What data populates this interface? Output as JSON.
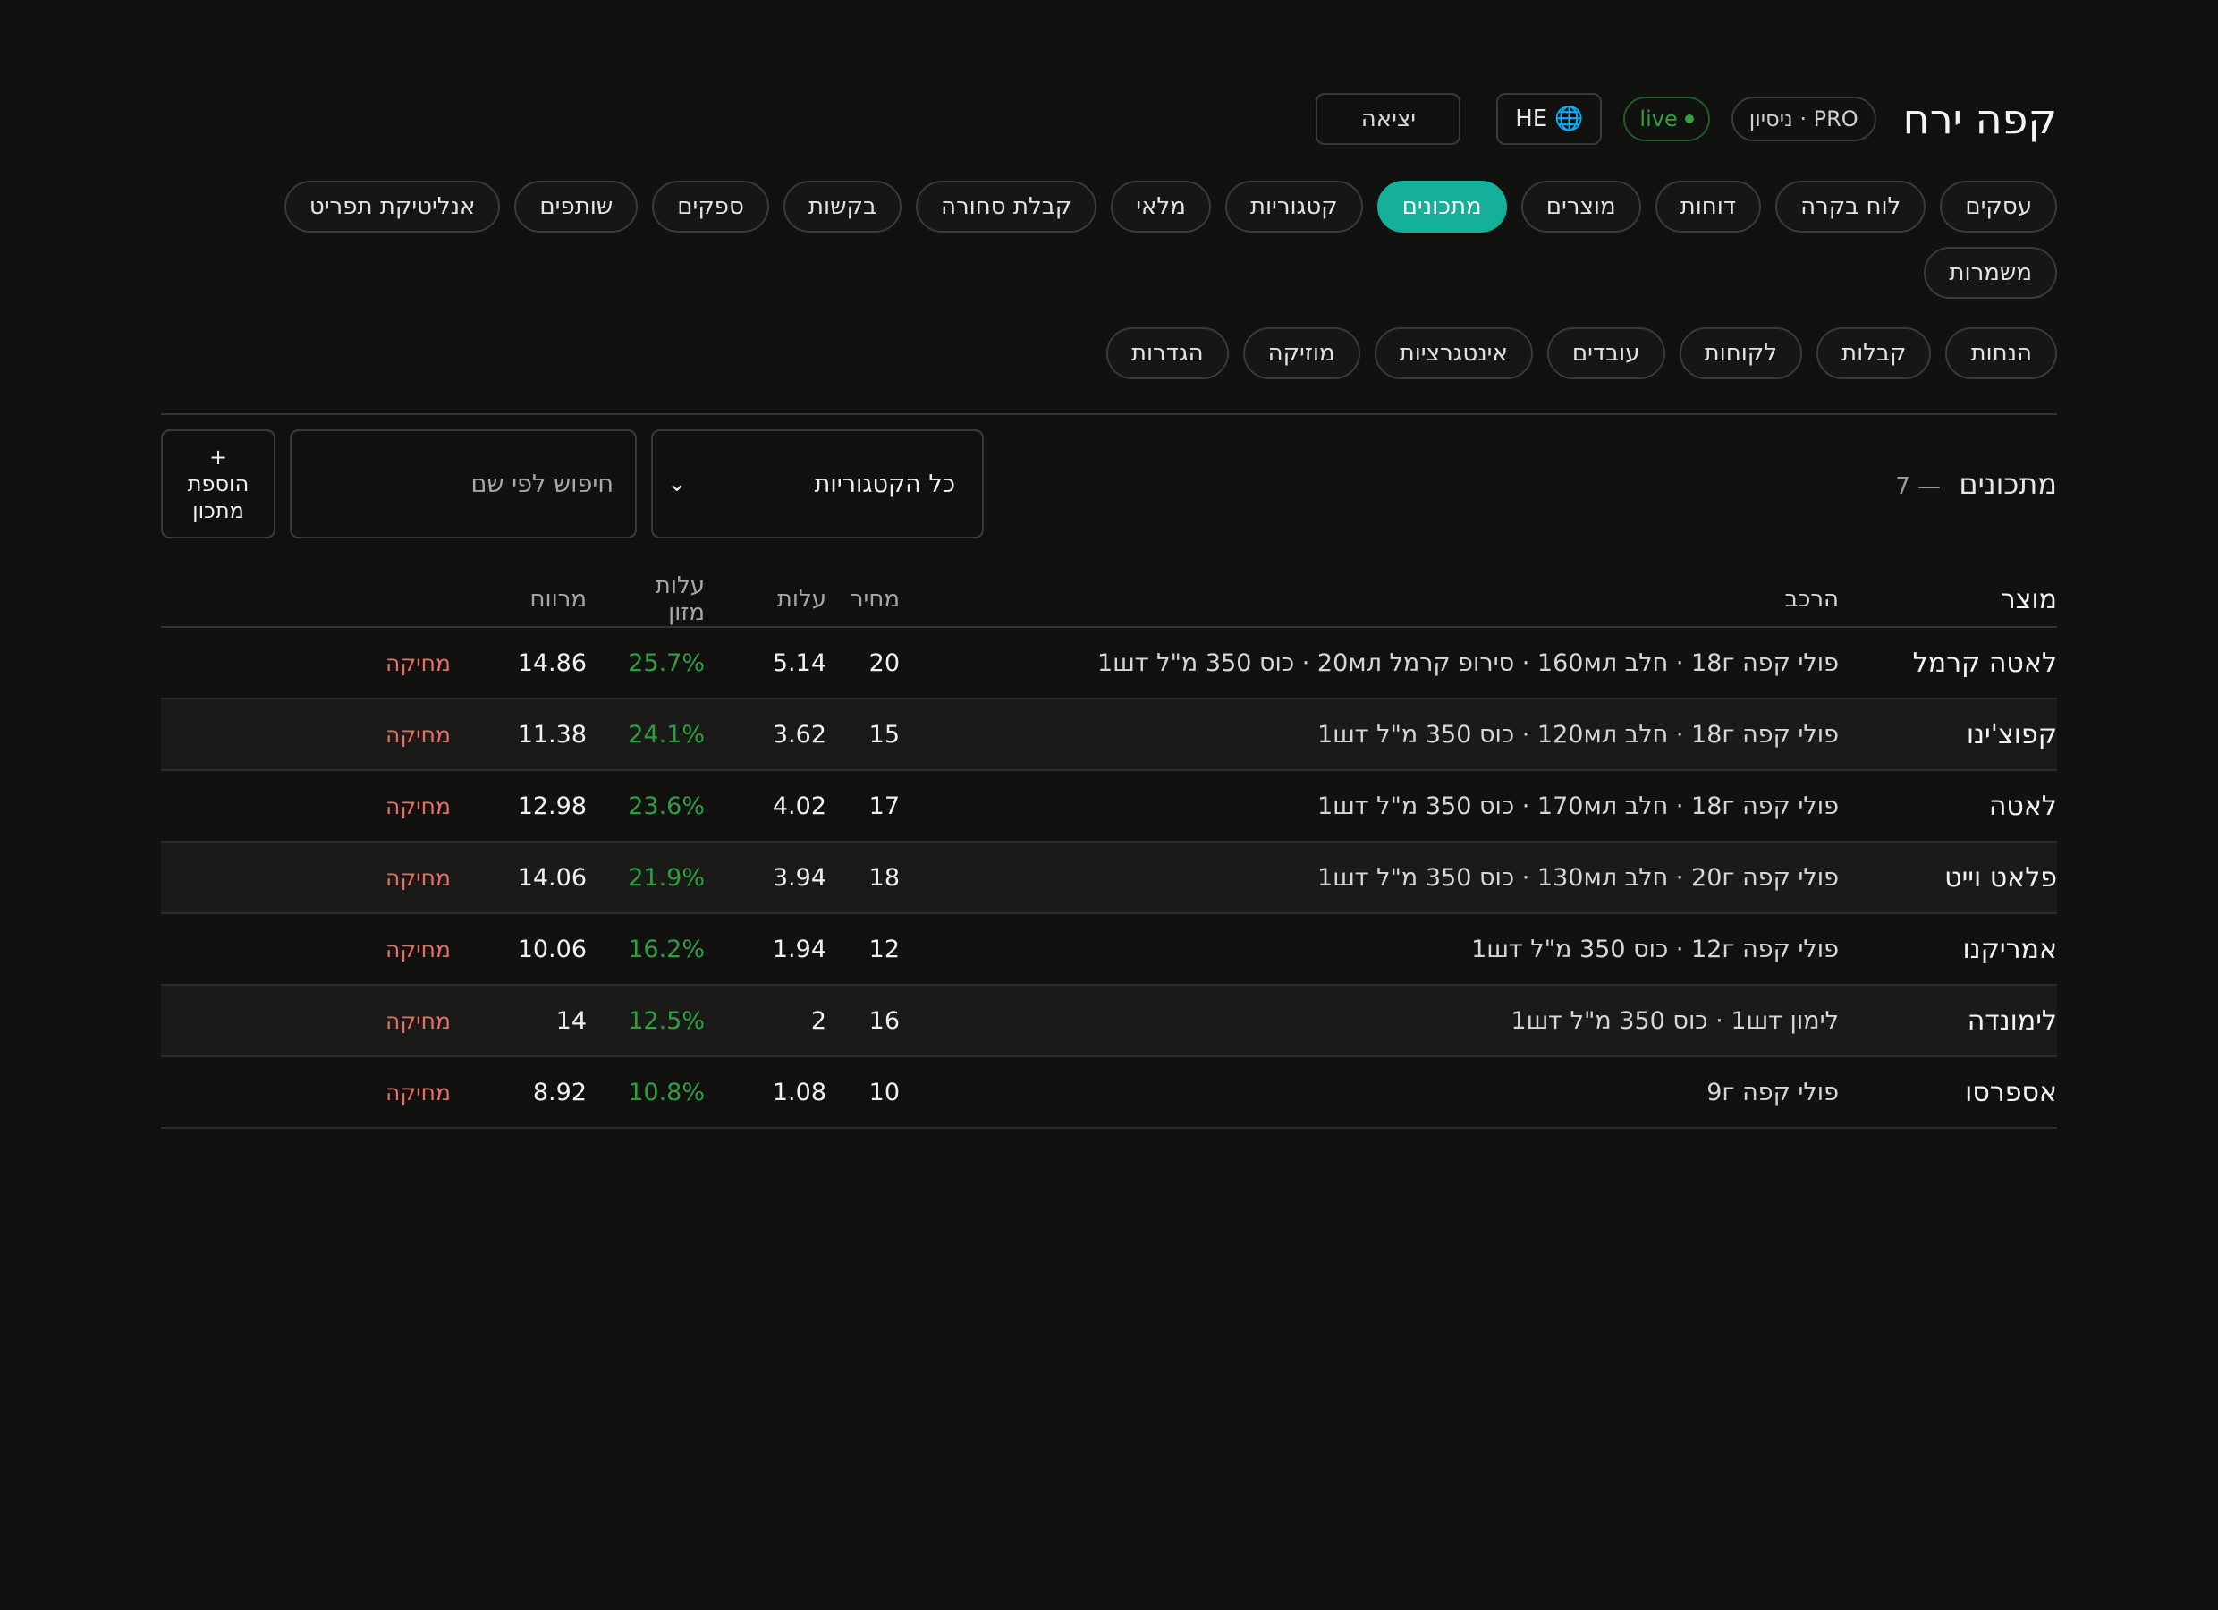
{
  "header": {
    "brand": "קפה ירח",
    "plan_badge": "PRO · ניסיון",
    "live_badge": "live",
    "language_label": "HE",
    "logout_label": "יציאה"
  },
  "nav": {
    "row1": [
      "עסקים",
      "לוח בקרה",
      "דוחות",
      "מוצרים",
      "מתכונים",
      "קטגוריות",
      "מלאי",
      "קבלת סחורה",
      "בקשות",
      "ספקים",
      "שותפים",
      "אנליטיקת תפריט",
      "משמרות"
    ],
    "row2": [
      "הנחות",
      "קבלות",
      "לקוחות",
      "עובדים",
      "אינטגרציות",
      "מוזיקה",
      "הגדרות"
    ],
    "active": "מתכונים"
  },
  "toolbar": {
    "title": "מתכונים",
    "count": "— 7",
    "category_filter": "כל הקטגוריות",
    "search_placeholder": "חיפוש לפי שם",
    "add_icon": "+",
    "add_line1": "הוספת",
    "add_line2": "מתכון"
  },
  "table": {
    "headers": {
      "product": "מוצר",
      "composition": "הרכב",
      "price": "מחיר",
      "cost": "עלות",
      "food_cost": "עלות מזון",
      "margin": "מרווח"
    },
    "delete_label": "מחיקה",
    "rows": [
      {
        "product": "לאטה קרמל",
        "composition": "פולי קפה 18г · חלב 160мл · סירופ קרמל 20мл · כוס 350 מ\"ל 1шт",
        "price": "20",
        "cost": "5.14",
        "food_cost": "25.7%",
        "margin": "14.86"
      },
      {
        "product": "קפוצ'ינו",
        "composition": "פולי קפה 18г · חלב 120мл · כוס 350 מ\"ל 1шт",
        "price": "15",
        "cost": "3.62",
        "food_cost": "24.1%",
        "margin": "11.38"
      },
      {
        "product": "לאטה",
        "composition": "פולי קפה 18г · חלב 170мл · כוס 350 מ\"ל 1шт",
        "price": "17",
        "cost": "4.02",
        "food_cost": "23.6%",
        "margin": "12.98"
      },
      {
        "product": "פלאט וייט",
        "composition": "פולי קפה 20г · חלב 130мл · כוס 350 מ\"ל 1шт",
        "price": "18",
        "cost": "3.94",
        "food_cost": "21.9%",
        "margin": "14.06"
      },
      {
        "product": "אמריקנו",
        "composition": "פולי קפה 12г · כוס 350 מ\"ל 1шт",
        "price": "12",
        "cost": "1.94",
        "food_cost": "16.2%",
        "margin": "10.06"
      },
      {
        "product": "לימונדה",
        "composition": "לימון 1шт · כוס 350 מ\"ל 1шт",
        "price": "16",
        "cost": "2",
        "food_cost": "12.5%",
        "margin": "14"
      },
      {
        "product": "אספרסו",
        "composition": "פולי קפה 9г",
        "price": "10",
        "cost": "1.08",
        "food_cost": "10.8%",
        "margin": "8.92"
      }
    ]
  },
  "colors": {
    "accent": "#14b09a",
    "positive": "#2e9e3e",
    "danger": "#ef6a64",
    "background": "#111110"
  },
  "icons": {
    "globe": "globe-icon",
    "chevron": "chevron-down-icon",
    "add": "plus-icon"
  }
}
